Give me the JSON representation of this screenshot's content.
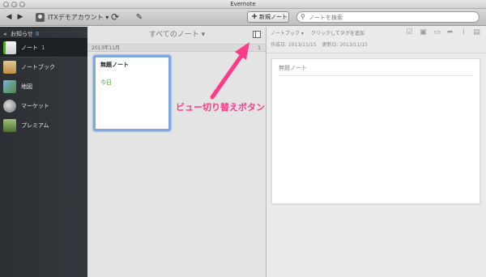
{
  "window": {
    "title": "Evernote"
  },
  "toolbar": {
    "account_label": "ITXデモアカウント ▾",
    "new_note_label": "新規ノート",
    "search_placeholder": "ノートを検索"
  },
  "sidebar": {
    "header_label": "お知らせ",
    "header_count": "8",
    "items": [
      {
        "label": "ノート",
        "count": "1",
        "icon": "note-icon"
      },
      {
        "label": "ノートブック",
        "count": "",
        "icon": "notebook-icon"
      },
      {
        "label": "地図",
        "count": "",
        "icon": "map-icon"
      },
      {
        "label": "マーケット",
        "count": "",
        "icon": "market-icon"
      },
      {
        "label": "プレミアム",
        "count": "",
        "icon": "premium-icon"
      }
    ]
  },
  "note_list": {
    "header": "すべてのノート ▾",
    "date_group": "2013年11月",
    "group_count": "1",
    "card_title": "無題ノート",
    "card_date": "今日"
  },
  "annotation": {
    "text": "ビュー切り替えボタン",
    "color": "#ff3b88"
  },
  "editor": {
    "notebook_select": "ノートブック ▾",
    "tag_placeholder": "クリックしてタグを追加",
    "created": "作成日: 2013/11/15",
    "updated": "更新日: 2013/11/15",
    "title_placeholder": "無題ノート"
  },
  "colors": {
    "accent_blue": "#7ea6e0",
    "date_green": "#47a32f",
    "sidebar_bg": "#2c3034"
  }
}
